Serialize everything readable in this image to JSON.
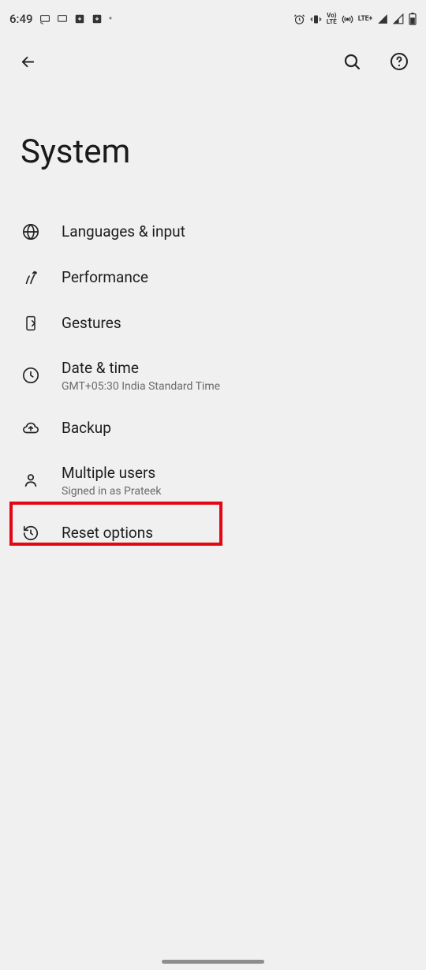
{
  "statusbar": {
    "time": "6:49",
    "lte": "LTE+"
  },
  "page": {
    "title": "System"
  },
  "settings": {
    "items": [
      {
        "label": "Languages & input",
        "sub": ""
      },
      {
        "label": "Performance",
        "sub": ""
      },
      {
        "label": "Gestures",
        "sub": ""
      },
      {
        "label": "Date & time",
        "sub": "GMT+05:30 India Standard Time"
      },
      {
        "label": "Backup",
        "sub": ""
      },
      {
        "label": "Multiple users",
        "sub": "Signed in as Prateek"
      },
      {
        "label": "Reset options",
        "sub": ""
      }
    ]
  },
  "highlight": {
    "index": 6
  }
}
